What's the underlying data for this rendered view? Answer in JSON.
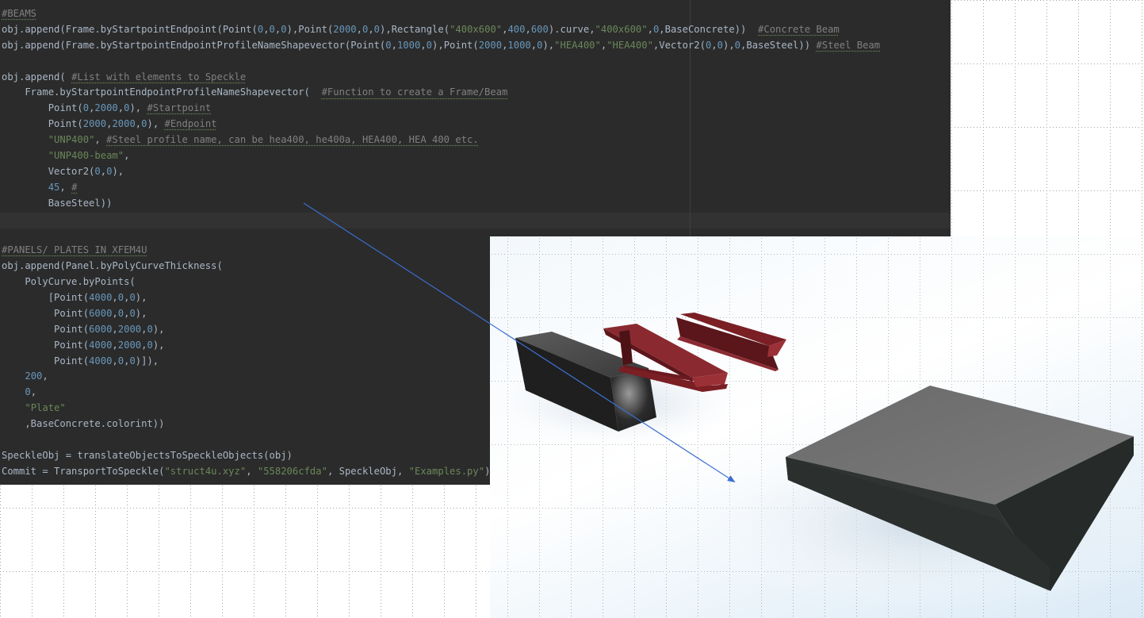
{
  "editor": {
    "lines": [
      [
        {
          "t": "#BEAMS",
          "c": "c"
        }
      ],
      [
        {
          "t": "obj.append(Frame.byStartpointEndpoint(Point(",
          "c": "k"
        },
        {
          "t": "0",
          "c": "n"
        },
        {
          "t": ",",
          "c": "k"
        },
        {
          "t": "0",
          "c": "n"
        },
        {
          "t": ",",
          "c": "k"
        },
        {
          "t": "0",
          "c": "n"
        },
        {
          "t": "),Point(",
          "c": "k"
        },
        {
          "t": "2000",
          "c": "n"
        },
        {
          "t": ",",
          "c": "k"
        },
        {
          "t": "0",
          "c": "n"
        },
        {
          "t": ",",
          "c": "k"
        },
        {
          "t": "0",
          "c": "n"
        },
        {
          "t": "),Rectangle(",
          "c": "k"
        },
        {
          "t": "\"400x600\"",
          "c": "s"
        },
        {
          "t": ",",
          "c": "k"
        },
        {
          "t": "400",
          "c": "n"
        },
        {
          "t": ",",
          "c": "k"
        },
        {
          "t": "600",
          "c": "n"
        },
        {
          "t": ").curve,",
          "c": "k"
        },
        {
          "t": "\"400x600\"",
          "c": "s"
        },
        {
          "t": ",",
          "c": "k"
        },
        {
          "t": "0",
          "c": "n"
        },
        {
          "t": ",BaseConcrete))  ",
          "c": "k"
        },
        {
          "t": "#Concrete Beam",
          "c": "c"
        }
      ],
      [
        {
          "t": "obj.append(Frame.byStartpointEndpointProfileNameShapevector(Point(",
          "c": "k"
        },
        {
          "t": "0",
          "c": "n"
        },
        {
          "t": ",",
          "c": "k"
        },
        {
          "t": "1000",
          "c": "n"
        },
        {
          "t": ",",
          "c": "k"
        },
        {
          "t": "0",
          "c": "n"
        },
        {
          "t": "),Point(",
          "c": "k"
        },
        {
          "t": "2000",
          "c": "n"
        },
        {
          "t": ",",
          "c": "k"
        },
        {
          "t": "1000",
          "c": "n"
        },
        {
          "t": ",",
          "c": "k"
        },
        {
          "t": "0",
          "c": "n"
        },
        {
          "t": "),",
          "c": "k"
        },
        {
          "t": "\"HEA400\"",
          "c": "s"
        },
        {
          "t": ",",
          "c": "k"
        },
        {
          "t": "\"HEA400\"",
          "c": "s"
        },
        {
          "t": ",Vector2(",
          "c": "k"
        },
        {
          "t": "0",
          "c": "n"
        },
        {
          "t": ",",
          "c": "k"
        },
        {
          "t": "0",
          "c": "n"
        },
        {
          "t": "),",
          "c": "k"
        },
        {
          "t": "0",
          "c": "n"
        },
        {
          "t": ",BaseSteel)) ",
          "c": "k"
        },
        {
          "t": "#Steel Beam",
          "c": "c"
        }
      ],
      [],
      [
        {
          "t": "obj.append( ",
          "c": "k"
        },
        {
          "t": "#List with elements to Speckle",
          "c": "c"
        }
      ],
      [
        {
          "t": "    Frame.byStartpointEndpointProfileNameShapevector(  ",
          "c": "k"
        },
        {
          "t": "#Function to create a Frame/Beam",
          "c": "c"
        }
      ],
      [
        {
          "t": "        Point(",
          "c": "k"
        },
        {
          "t": "0",
          "c": "n"
        },
        {
          "t": ",",
          "c": "k"
        },
        {
          "t": "2000",
          "c": "n"
        },
        {
          "t": ",",
          "c": "k"
        },
        {
          "t": "0",
          "c": "n"
        },
        {
          "t": "), ",
          "c": "k"
        },
        {
          "t": "#Startpoint",
          "c": "c"
        }
      ],
      [
        {
          "t": "        Point(",
          "c": "k"
        },
        {
          "t": "2000",
          "c": "n"
        },
        {
          "t": ",",
          "c": "k"
        },
        {
          "t": "2000",
          "c": "n"
        },
        {
          "t": ",",
          "c": "k"
        },
        {
          "t": "0",
          "c": "n"
        },
        {
          "t": "), ",
          "c": "k"
        },
        {
          "t": "#Endpoint",
          "c": "c"
        }
      ],
      [
        {
          "t": "        ",
          "c": "k"
        },
        {
          "t": "\"UNP400\"",
          "c": "s"
        },
        {
          "t": ", ",
          "c": "k"
        },
        {
          "t": "#Steel profile name, can be hea400, he400a, HEA400, HEA 400 etc.",
          "c": "c"
        }
      ],
      [
        {
          "t": "        ",
          "c": "k"
        },
        {
          "t": "\"UNP400-beam\"",
          "c": "s"
        },
        {
          "t": ",",
          "c": "k"
        }
      ],
      [
        {
          "t": "        Vector2(",
          "c": "k"
        },
        {
          "t": "0",
          "c": "n"
        },
        {
          "t": ",",
          "c": "k"
        },
        {
          "t": "0",
          "c": "n"
        },
        {
          "t": "),",
          "c": "k"
        }
      ],
      [
        {
          "t": "        ",
          "c": "k"
        },
        {
          "t": "45",
          "c": "n"
        },
        {
          "t": ", ",
          "c": "k"
        },
        {
          "t": "#",
          "c": "c"
        }
      ],
      [
        {
          "t": "        BaseSteel))",
          "c": "k"
        }
      ],
      [],
      [],
      [
        {
          "t": "#PANELS/ PLATES IN XFEM4U",
          "c": "c"
        }
      ],
      [
        {
          "t": "obj.append(Panel.byPolyCurveThickness(",
          "c": "k"
        }
      ],
      [
        {
          "t": "    PolyCurve.byPoints(",
          "c": "k"
        }
      ],
      [
        {
          "t": "        [Point(",
          "c": "k"
        },
        {
          "t": "4000",
          "c": "n"
        },
        {
          "t": ",",
          "c": "k"
        },
        {
          "t": "0",
          "c": "n"
        },
        {
          "t": ",",
          "c": "k"
        },
        {
          "t": "0",
          "c": "n"
        },
        {
          "t": "),",
          "c": "k"
        }
      ],
      [
        {
          "t": "         Point(",
          "c": "k"
        },
        {
          "t": "6000",
          "c": "n"
        },
        {
          "t": ",",
          "c": "k"
        },
        {
          "t": "0",
          "c": "n"
        },
        {
          "t": ",",
          "c": "k"
        },
        {
          "t": "0",
          "c": "n"
        },
        {
          "t": "),",
          "c": "k"
        }
      ],
      [
        {
          "t": "         Point(",
          "c": "k"
        },
        {
          "t": "6000",
          "c": "n"
        },
        {
          "t": ",",
          "c": "k"
        },
        {
          "t": "2000",
          "c": "n"
        },
        {
          "t": ",",
          "c": "k"
        },
        {
          "t": "0",
          "c": "n"
        },
        {
          "t": "),",
          "c": "k"
        }
      ],
      [
        {
          "t": "         Point(",
          "c": "k"
        },
        {
          "t": "4000",
          "c": "n"
        },
        {
          "t": ",",
          "c": "k"
        },
        {
          "t": "2000",
          "c": "n"
        },
        {
          "t": ",",
          "c": "k"
        },
        {
          "t": "0",
          "c": "n"
        },
        {
          "t": "),",
          "c": "k"
        }
      ],
      [
        {
          "t": "         Point(",
          "c": "k"
        },
        {
          "t": "4000",
          "c": "n"
        },
        {
          "t": ",",
          "c": "k"
        },
        {
          "t": "0",
          "c": "n"
        },
        {
          "t": ",",
          "c": "k"
        },
        {
          "t": "0",
          "c": "n"
        },
        {
          "t": ")]),",
          "c": "k"
        }
      ],
      [
        {
          "t": "    ",
          "c": "k"
        },
        {
          "t": "200",
          "c": "n"
        },
        {
          "t": ",",
          "c": "k"
        }
      ],
      [
        {
          "t": "    ",
          "c": "k"
        },
        {
          "t": "0",
          "c": "n"
        },
        {
          "t": ",",
          "c": "k"
        }
      ],
      [
        {
          "t": "    ",
          "c": "k"
        },
        {
          "t": "\"Plate\"",
          "c": "s"
        }
      ],
      [
        {
          "t": "    ,BaseConcrete.colorint))",
          "c": "k"
        }
      ],
      [],
      [
        {
          "t": "SpeckleObj = translateObjectsToSpeckleObjects(obj)",
          "c": "k"
        }
      ],
      [
        {
          "t": "Commit = TransportToSpeckle(",
          "c": "k"
        },
        {
          "t": "\"struct4u.xyz\"",
          "c": "s"
        },
        {
          "t": ", ",
          "c": "k"
        },
        {
          "t": "\"558206cfda\"",
          "c": "s"
        },
        {
          "t": ", SpeckleObj, ",
          "c": "k"
        },
        {
          "t": "\"Examples.py\"",
          "c": "s"
        },
        {
          "t": ")",
          "c": "k"
        }
      ]
    ]
  },
  "colors": {
    "editor_bg": "#2b2b2b",
    "comment": "#808080",
    "string": "#6a8759",
    "number": "#6897bb",
    "text": "#a9b7c6",
    "steel": "#7a1f24",
    "concrete_beam": "#2a2a2a",
    "plate_top": "#6e6e6e",
    "arrow": "#3b6fd0"
  }
}
